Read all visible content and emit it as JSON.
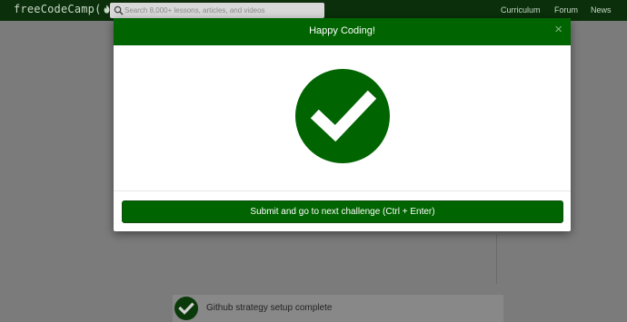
{
  "navbar": {
    "logo_text_left": "freeCodeCamp(",
    "logo_text_right": ")",
    "search_placeholder": "Search 8,000+ lessons, articles, and videos",
    "links": [
      "Curriculum",
      "Forum",
      "News"
    ]
  },
  "background": {
    "completed_item": "Github strategy setup complete"
  },
  "modal": {
    "title": "Happy Coding!",
    "close_symbol": "×",
    "submit_label": "Submit and go to next challenge (Ctrl + Enter)"
  },
  "colors": {
    "primary_green": "#006400",
    "overlay_grey": "#7b7b7b",
    "white": "#ffffff"
  },
  "icons": [
    "search-icon",
    "fire-icon",
    "close-icon",
    "check-circle-icon"
  ]
}
